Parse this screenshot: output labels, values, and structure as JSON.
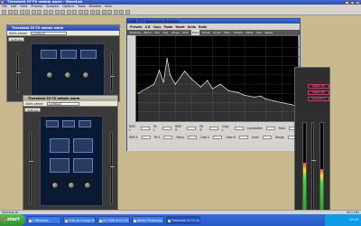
{
  "app": {
    "title": "Threshold 2V FX nebula warm - WaveLab",
    "menu": [
      "File",
      "Edit",
      "View",
      "Process",
      "Analysis",
      "Options",
      "Tools",
      "Window",
      "Help"
    ]
  },
  "plugin_window_1": {
    "title": "Threshold 2V FX nebula warm",
    "preset_label": "Stalls preset",
    "preset_value": "(untitled)",
    "settings_label": "Settings"
  },
  "plugin_window_2": {
    "title": "Threshold 2V FX nebula warm",
    "preset_label": "Stalls preset",
    "preset_value": "(untitled)",
    "settings_label": "Settings"
  },
  "spectrum": {
    "title": "SPAN FFT Spectrum Analyzer",
    "toolbar": [
      "Presets",
      "A B",
      "Copy",
      "Paste",
      "Reset",
      "Undo",
      "Redo"
    ],
    "tabs": [
      "Routing",
      "Block",
      "Ovl",
      "Avg",
      "Slope",
      "Pink",
      "Style",
      "Mode",
      "Scale",
      "Max",
      "Freeze",
      "Band",
      "Abs",
      "Reset"
    ],
    "footer_row1": [
      "RMS L",
      "Pk L",
      "RMS R",
      "Pk R",
      "Clips L",
      "Correlation",
      "Peak"
    ],
    "footer_row2": [
      "RMS S",
      "Pk S",
      "Mono",
      "Clips S",
      "Clips R",
      "Level",
      "Range"
    ],
    "accent": "#2a4aa8"
  },
  "meters": {
    "channels": [
      "Master M1",
      "Master M2",
      "Group Ch A"
    ],
    "levels": [
      0.55,
      0.48
    ],
    "accent": "#c04060"
  },
  "statusline": {
    "left": "Opening ok",
    "right": "44.1 kHz"
  },
  "taskbar": {
    "start_label": "start",
    "tasks": [
      "2 Windows...",
      "Guia de mixage tecnicas",
      "ze 1308 Sent (1/51) -",
      "Adobe Photoshop",
      "Threshold 2V FX nebu"
    ],
    "clock": "19:45"
  },
  "chart_data": {
    "type": "line",
    "title": "SPAN FFT Spectrum Analyzer",
    "xlabel": "",
    "ylabel": "",
    "x": [
      20,
      30,
      40,
      50,
      60,
      70,
      80,
      100,
      150,
      200,
      300,
      400,
      500,
      700,
      1000,
      1500,
      2000,
      3000,
      4000,
      5000,
      7000,
      10000,
      15000,
      20000
    ],
    "series": [
      {
        "values": [
          -60,
          -54,
          -50,
          -35,
          -48,
          -22,
          -40,
          -50,
          -36,
          -44,
          -53,
          -46,
          -55,
          -50,
          -57,
          -59,
          -62,
          -64,
          -63,
          -66,
          -68,
          -70,
          -72,
          -74
        ]
      }
    ],
    "ylim": [
      -90,
      0
    ],
    "grid": true,
    "xscale": "log"
  }
}
